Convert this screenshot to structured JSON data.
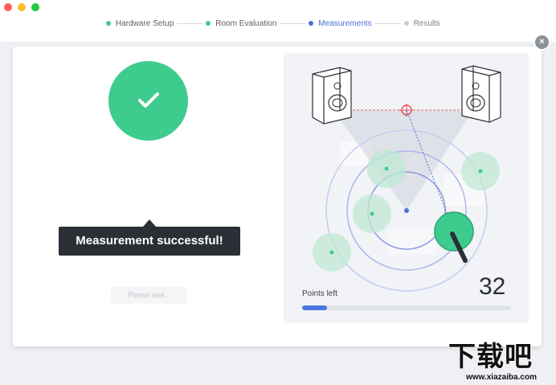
{
  "window": {
    "traffic_lights": {
      "close": "#ff5f57",
      "minimize": "#febc2e",
      "zoom": "#28c840"
    }
  },
  "steps": [
    {
      "label": "Hardware Setup",
      "state": "done",
      "color": "#3ecb8e"
    },
    {
      "label": "Room Evaluation",
      "state": "done",
      "color": "#3ecb8e"
    },
    {
      "label": "Measurements",
      "state": "active",
      "color": "#4a6fd8"
    },
    {
      "label": "Results",
      "state": "pending",
      "color": "#c8ccd2"
    }
  ],
  "close_button": {
    "glyph": "×"
  },
  "status": {
    "icon": "check-icon",
    "message": "Measurement successful!",
    "button_label": "Please wait..."
  },
  "measurement": {
    "points_left_label": "Points left",
    "points_left_value": "32",
    "progress_fraction": 0.12
  },
  "watermark": {
    "main": "下载吧",
    "sub": "www.xiazaiba.com"
  },
  "colors": {
    "accent": "#4a6fd8",
    "success": "#3ecb8e",
    "tooltip": "#2b2f35"
  }
}
